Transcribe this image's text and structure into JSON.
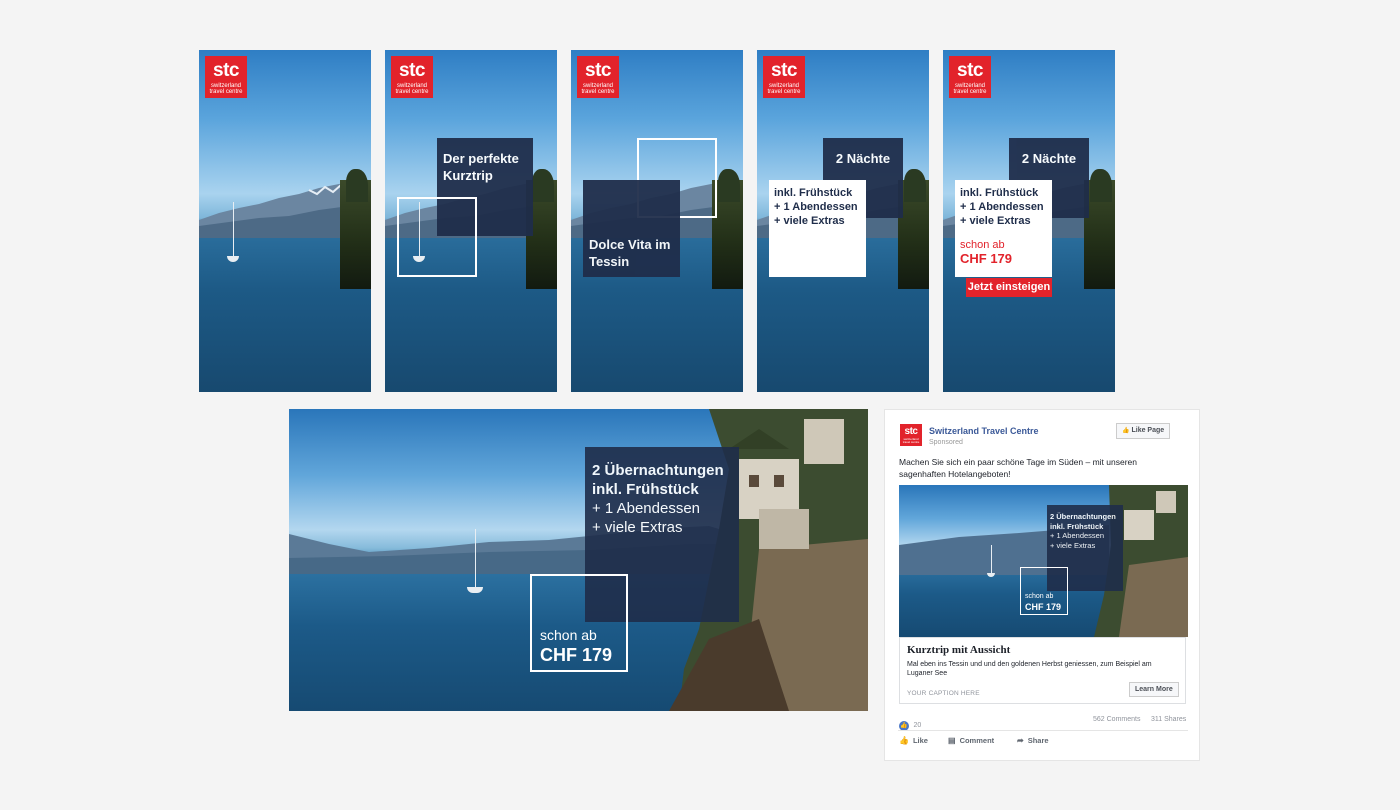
{
  "brand": {
    "logo_text": "stc",
    "logo_sub": "switzerland travel centre",
    "accent": "#e2232b",
    "navy": "#1f2d4a"
  },
  "banners": {
    "b2": {
      "text": "Der perfekte Kurztrip"
    },
    "b3": {
      "text": "Dolce Vita im Tessin"
    },
    "b4": {
      "nights": "2 Nächte",
      "extras_1": "inkl. Frühstück",
      "extras_2": "+ 1 Abendessen",
      "extras_3": "+ viele Extras"
    },
    "b5": {
      "nights": "2 Nächte",
      "extras_1": "inkl. Frühstück",
      "extras_2": "+ 1 Abendessen",
      "extras_3": "+ viele Extras",
      "price_prefix": "schon ab",
      "price": "CHF 179",
      "cta": "Jetzt einsteigen"
    }
  },
  "wide": {
    "line1": "2 Übernachtungen",
    "line2": "inkl. Frühstück",
    "line3": "+ 1 Abendessen",
    "line4": "+ viele Extras",
    "price_prefix": "schon ab",
    "price": "CHF 179"
  },
  "fb": {
    "page_name": "Switzerland Travel Centre",
    "sponsored": "Sponsored",
    "like_page": "Like Page",
    "post_text": "Machen Sie sich ein paar schöne Tage im Süden – mit unseren sagenhaften Hotelangeboten!",
    "image": {
      "line1": "2 Übernachtungen",
      "line2": "inkl. Frühstück",
      "line3": "+ 1 Abendessen",
      "line4": "+ viele Extras",
      "price_prefix": "schon ab",
      "price": "CHF 179"
    },
    "headline": "Kurztrip mit Aussicht",
    "description": "Mal eben ins Tessin und und den goldenen Herbst geniessen, zum Beispiel am Luganer See",
    "caption": "YOUR CAPTION HERE",
    "learn_more": "Learn More",
    "likes": "20",
    "comments": "562 Comments",
    "shares": "311 Shares",
    "action_like": "Like",
    "action_comment": "Comment",
    "action_share": "Share",
    "like_icon_glyph": "👍",
    "comment_icon_glyph": "▤",
    "share_icon_glyph": "➦",
    "reaction_icon_glyph": "👍"
  }
}
